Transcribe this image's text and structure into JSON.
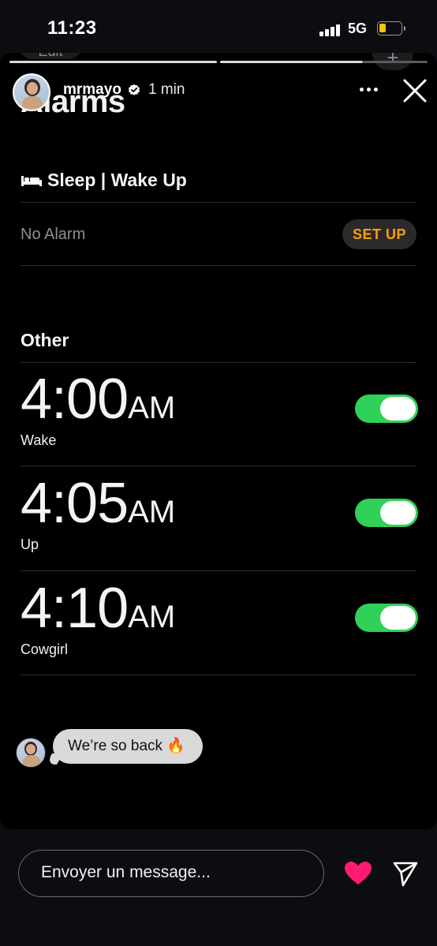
{
  "status_bar": {
    "time": "11:23",
    "network": "5G",
    "battery_level": 0.25,
    "signal_bars": 4
  },
  "story": {
    "progress": [
      {
        "state": "viewed"
      },
      {
        "state": "current"
      },
      {
        "state": "upcoming"
      }
    ],
    "header": {
      "username": "mrmayo",
      "time_ago": "1 min",
      "verified": true
    },
    "background_partial": {
      "edit_label": "Edit",
      "add_label": "+"
    },
    "alarms_screen": {
      "title": "Alarms",
      "sleep_section_title": "Sleep | Wake Up",
      "no_alarm_text": "No Alarm",
      "setup_label": "SET UP",
      "other_title": "Other",
      "alarms": [
        {
          "hour_min": "4:00",
          "ampm": "AM",
          "label": "Wake",
          "enabled": true
        },
        {
          "hour_min": "4:05",
          "ampm": "AM",
          "label": "Up",
          "enabled": true
        },
        {
          "hour_min": "4:10",
          "ampm": "AM",
          "label": "Cowgirl",
          "enabled": true
        }
      ]
    },
    "reply": {
      "text": "We’re so back 🔥"
    }
  },
  "composer": {
    "placeholder": "Envoyer un message..."
  },
  "colors": {
    "toggle_on": "#30d158",
    "setup_text": "#ff9f0a",
    "heart": "#ff1a72",
    "battery_fill": "#f5c400"
  }
}
